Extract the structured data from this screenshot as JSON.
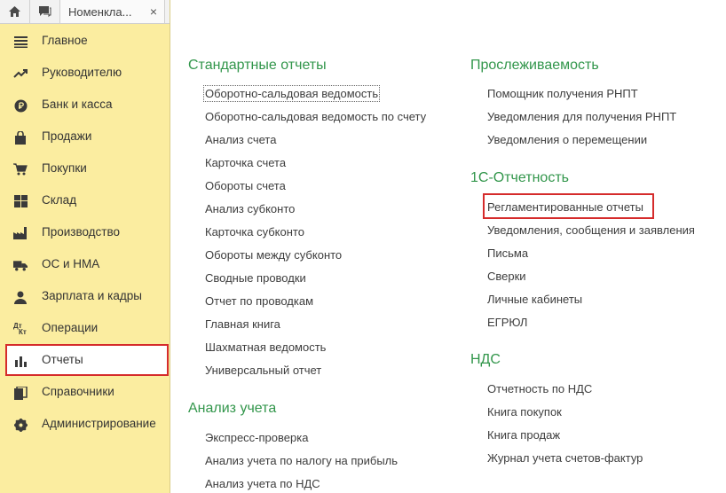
{
  "tabbar": {
    "home_icon": "home-icon",
    "messages_icon": "chat-icon",
    "open_tab_label": "Номенкла...",
    "close_label": "×"
  },
  "sidebar": {
    "items": [
      {
        "label": "Главное",
        "icon": "menu-lines-icon"
      },
      {
        "label": "Руководителю",
        "icon": "trend-icon"
      },
      {
        "label": "Банк и касса",
        "icon": "ruble-icon"
      },
      {
        "label": "Продажи",
        "icon": "bag-icon"
      },
      {
        "label": "Покупки",
        "icon": "cart-icon"
      },
      {
        "label": "Склад",
        "icon": "warehouse-icon"
      },
      {
        "label": "Производство",
        "icon": "factory-icon"
      },
      {
        "label": "ОС и НМА",
        "icon": "truck-icon"
      },
      {
        "label": "Зарплата и кадры",
        "icon": "person-icon"
      },
      {
        "label": "Операции",
        "icon": "dt-kt-icon"
      },
      {
        "label": "Отчеты",
        "icon": "bar-chart-icon",
        "active": true
      },
      {
        "label": "Справочники",
        "icon": "books-icon"
      },
      {
        "label": "Администрирование",
        "icon": "gear-icon"
      }
    ],
    "dt_label": "Дт",
    "kt_label": "Кт"
  },
  "main": {
    "left": {
      "sections": [
        {
          "title": "Стандартные отчеты",
          "items": [
            "Оборотно-сальдовая ведомость",
            "Оборотно-сальдовая ведомость по счету",
            "Анализ счета",
            "Карточка счета",
            "Обороты счета",
            "Анализ субконто",
            "Карточка субконто",
            "Обороты между субконто",
            "Сводные проводки",
            "Отчет по проводкам",
            "Главная книга",
            "Шахматная ведомость",
            "Универсальный отчет"
          ]
        },
        {
          "title": "Анализ учета",
          "items": [
            "Экспресс-проверка",
            "Анализ учета по налогу на прибыль",
            "Анализ учета по НДС"
          ]
        }
      ]
    },
    "right": {
      "sections": [
        {
          "title": "Прослеживаемость",
          "items": [
            "Помощник получения РНПТ",
            "Уведомления для получения РНПТ",
            "Уведомления о перемещении"
          ]
        },
        {
          "title": "1С-Отчетность",
          "items": [
            "Регламентированные отчеты",
            "Уведомления, сообщения и заявления",
            "Письма",
            "Сверки",
            "Личные кабинеты",
            "ЕГРЮЛ"
          ]
        },
        {
          "title": "НДС",
          "items": [
            "Отчетность по НДС",
            "Книга покупок",
            "Книга продаж",
            "Журнал учета счетов-фактур"
          ]
        }
      ]
    }
  },
  "colors": {
    "sidebar_bg": "#fbeda0",
    "section_title": "#32964b",
    "highlight": "#d52b2b",
    "text": "#3d3d3d"
  }
}
